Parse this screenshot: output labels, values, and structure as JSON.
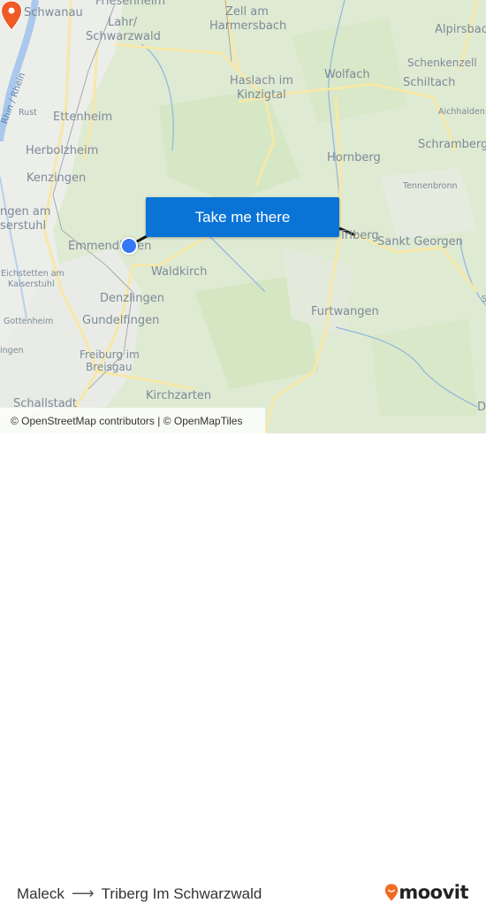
{
  "map": {
    "places": [
      {
        "name": "Friesenheim",
        "size": "big"
      },
      {
        "name": "Schwanau",
        "size": "big"
      },
      {
        "name": "Lahr/",
        "size": "big"
      },
      {
        "name": "Schwarzwald",
        "size": "big"
      },
      {
        "name": "Zell am",
        "size": "big"
      },
      {
        "name": "Harmersbach",
        "size": "big"
      },
      {
        "name": "Alpirsbach",
        "size": "big"
      },
      {
        "name": "Schenkenzell",
        "size": "med"
      },
      {
        "name": "Wolfach",
        "size": "big"
      },
      {
        "name": "Haslach im",
        "size": "big"
      },
      {
        "name": "Kinzigtal",
        "size": "big"
      },
      {
        "name": "Schiltach",
        "size": "big"
      },
      {
        "name": "Aichhalden",
        "size": "small"
      },
      {
        "name": "Rust",
        "size": "small"
      },
      {
        "name": "Ettenheim",
        "size": "big"
      },
      {
        "name": "Herbolzheim",
        "size": "big"
      },
      {
        "name": "Schramberg",
        "size": "big"
      },
      {
        "name": "Hornberg",
        "size": "big"
      },
      {
        "name": "Kenzingen",
        "size": "big"
      },
      {
        "name": "Tennenbronn",
        "size": "small"
      },
      {
        "name": "ngen am",
        "size": "big"
      },
      {
        "name": "serstuhl",
        "size": "big"
      },
      {
        "name": "Emmendingen",
        "size": "big"
      },
      {
        "name": "Triberg",
        "size": "big"
      },
      {
        "name": "Sankt Georgen",
        "size": "big"
      },
      {
        "name": "Waldkirch",
        "size": "big"
      },
      {
        "name": "Eichstetten am",
        "size": "small"
      },
      {
        "name": "Kaiserstuhl",
        "size": "small"
      },
      {
        "name": "Denzlingen",
        "size": "big"
      },
      {
        "name": "Furtwangen",
        "size": "big"
      },
      {
        "name": "Gottenheim",
        "size": "small"
      },
      {
        "name": "Gundelfingen",
        "size": "big"
      },
      {
        "name": "ingen",
        "size": "small"
      },
      {
        "name": "Freiburg im",
        "size": "med"
      },
      {
        "name": "Breisgau",
        "size": "med"
      },
      {
        "name": "Kirchzarten",
        "size": "big"
      },
      {
        "name": "Schallstadt",
        "size": "big"
      },
      {
        "name": "D",
        "size": "big"
      },
      {
        "name": "S",
        "size": "small"
      }
    ],
    "river_label": "Rhin / Rhein",
    "cta_label": "Take me there",
    "attribution": "© OpenStreetMap contributors | © OpenMapTiles",
    "origin_marker": "origin-pin",
    "destination_marker": "destination-pin",
    "colors": {
      "cta": "#0a74d6",
      "origin": "#3478f6",
      "destination": "#f05a24",
      "route_line": "#1a1a1a"
    }
  },
  "footer": {
    "origin": "Maleck",
    "arrow": "⟶",
    "destination": "Triberg Im Schwarzwald",
    "logo_text": "moovit",
    "logo_color": "#f26b21"
  }
}
